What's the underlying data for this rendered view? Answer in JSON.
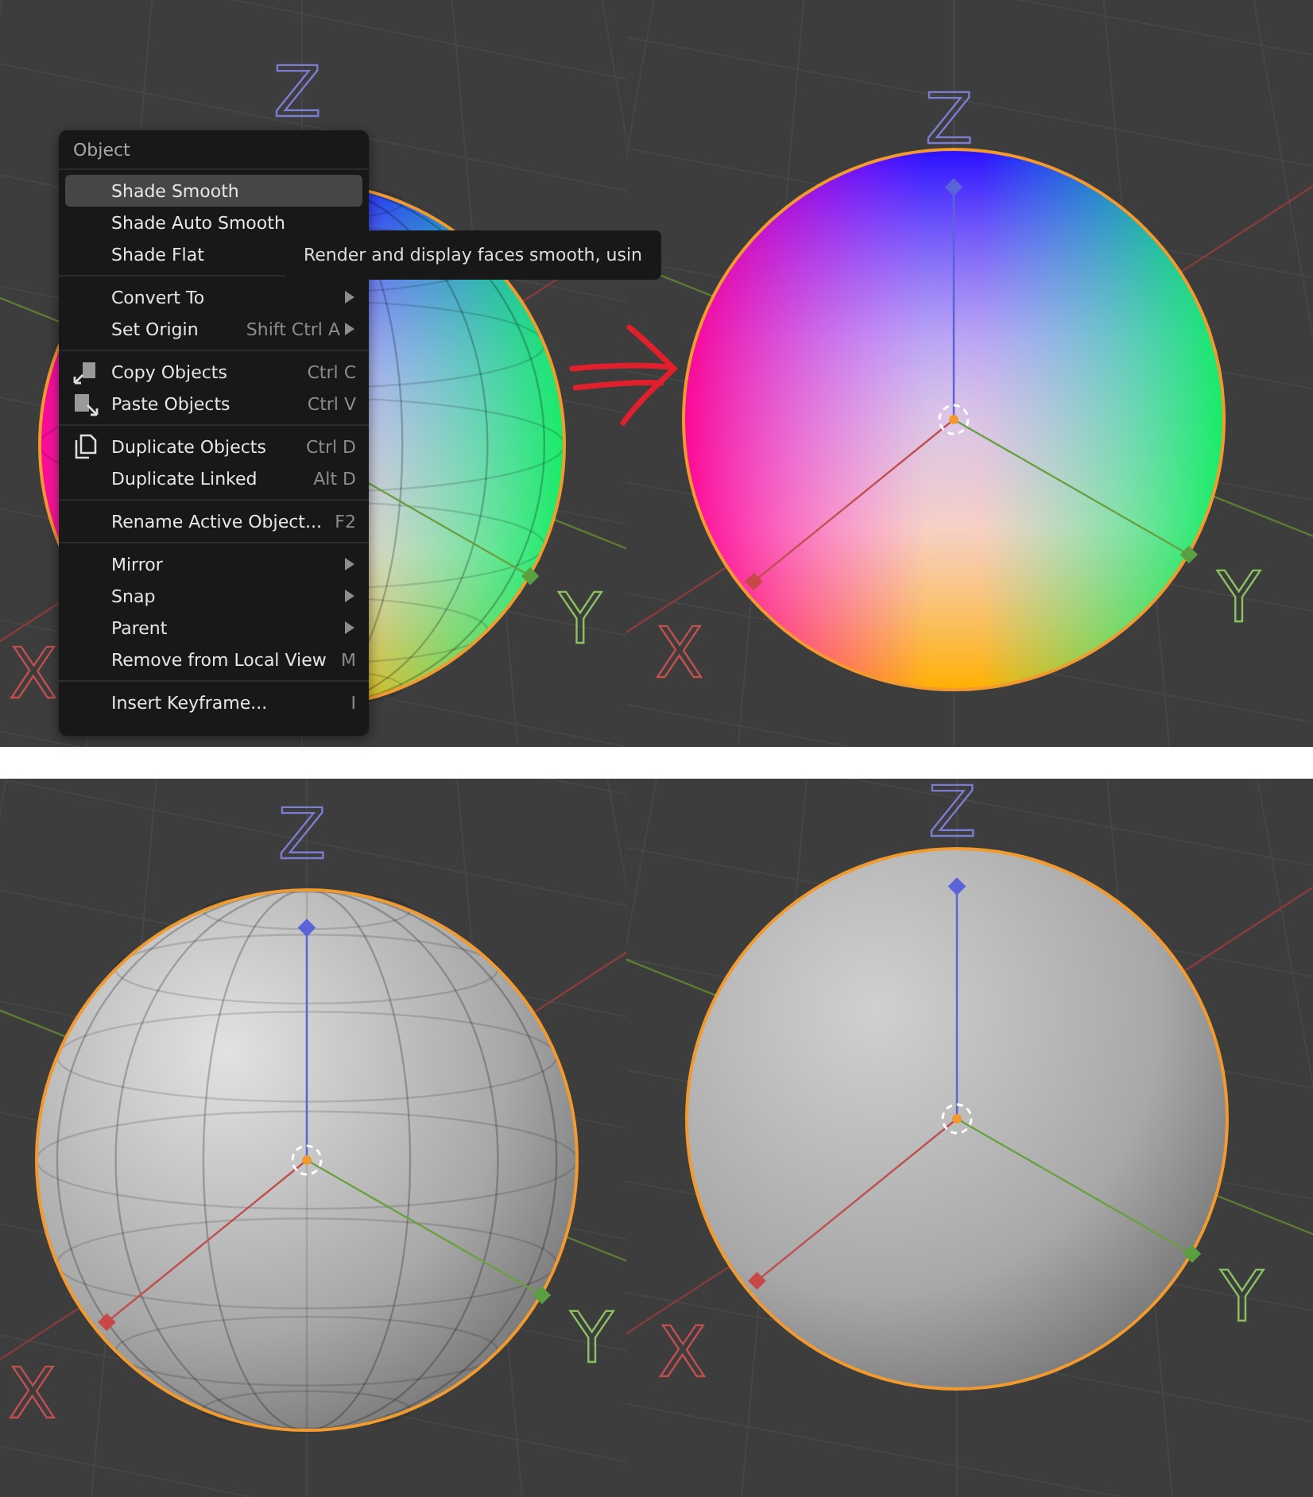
{
  "panels": [
    {
      "axis_labels": {
        "z": "Z",
        "y": "Y",
        "x": "X"
      }
    },
    {
      "axis_labels": {
        "z": "Z",
        "y": "Y",
        "x": "X"
      }
    },
    {
      "axis_labels": {
        "z": "Z",
        "y": "Y",
        "x": "X"
      }
    },
    {
      "axis_labels": {
        "z": "Z",
        "y": "Y",
        "x": "X"
      }
    }
  ],
  "context_menu": {
    "title": "Object",
    "sections": [
      [
        {
          "label": "Shade Smooth",
          "submenu": false,
          "selected": true
        },
        {
          "label": "Shade Auto Smooth",
          "submenu": false,
          "selected": false
        },
        {
          "label": "Shade Flat",
          "submenu": false,
          "selected": false
        }
      ],
      [
        {
          "label": "Convert To",
          "submenu": true,
          "selected": false
        },
        {
          "label": "Set Origin",
          "shortcut": "Shift Ctrl A",
          "submenu": true,
          "selected": false
        }
      ],
      [
        {
          "label": "Copy Objects",
          "shortcut": "Ctrl C",
          "submenu": false,
          "selected": false
        },
        {
          "label": "Paste Objects",
          "shortcut": "Ctrl V",
          "submenu": false,
          "selected": false
        }
      ],
      [
        {
          "label": "Duplicate Objects",
          "shortcut": "Ctrl D",
          "submenu": false,
          "selected": false
        },
        {
          "label": "Duplicate Linked",
          "shortcut": "Alt D",
          "submenu": false,
          "selected": false
        }
      ],
      [
        {
          "label": "Rename Active Object...",
          "shortcut": "F2",
          "submenu": false,
          "selected": false
        }
      ],
      [
        {
          "label": "Mirror",
          "submenu": true,
          "selected": false
        },
        {
          "label": "Snap",
          "submenu": true,
          "selected": false
        },
        {
          "label": "Parent",
          "submenu": true,
          "selected": false
        },
        {
          "label": "Remove from Local View",
          "shortcut": "M",
          "submenu": false,
          "selected": false
        }
      ],
      [
        {
          "label": "Insert Keyframe...",
          "shortcut": "I",
          "submenu": false,
          "selected": false
        }
      ]
    ]
  },
  "tooltip": "Render and display faces smooth, usin"
}
